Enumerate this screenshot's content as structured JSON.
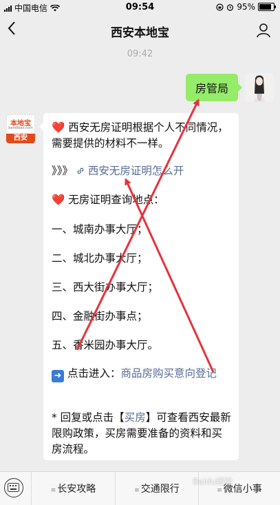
{
  "status_bar": {
    "carrier": "中国电信",
    "time": "09:54",
    "battery": "95%",
    "battery_level": 0.95
  },
  "header": {
    "title": "西安本地宝"
  },
  "chat": {
    "timestamp": "09:42",
    "user_message": "房管局",
    "bot_avatar": {
      "logo_text": "本地宝",
      "logo_sub": "bendibao.com",
      "city": "西安"
    },
    "reply": {
      "intro": "西安无房证明根据个人不同情况，需要提供的材料不一样。",
      "link_prefix": "》》》",
      "link_label": "西安无房证明怎么开",
      "query_heading": "无房证明查询地点：",
      "locations": [
        "一、城南办事大厅；",
        "二、城北办事大厅；",
        "三、西大街办事大厅；",
        "四、金融街办事点；",
        "五、香米园办事大厅。"
      ],
      "enter_prefix": "点击进入：",
      "enter_link": "商品房购买意向登记",
      "note_prefix": "* 回复或点击【",
      "note_link": "买房",
      "note_suffix": "】可查看西安最新限购政策，买房需要准备的资料和买房流程。"
    }
  },
  "bottom_menu": {
    "items": [
      "长安攻略",
      "交通限行",
      "微信小事"
    ]
  },
  "watermark": "Baidu经验",
  "colors": {
    "chat_background": "#ededed",
    "user_bubble": "#95ec69",
    "link": "#576b95",
    "annotation_red": "#e8313a"
  }
}
